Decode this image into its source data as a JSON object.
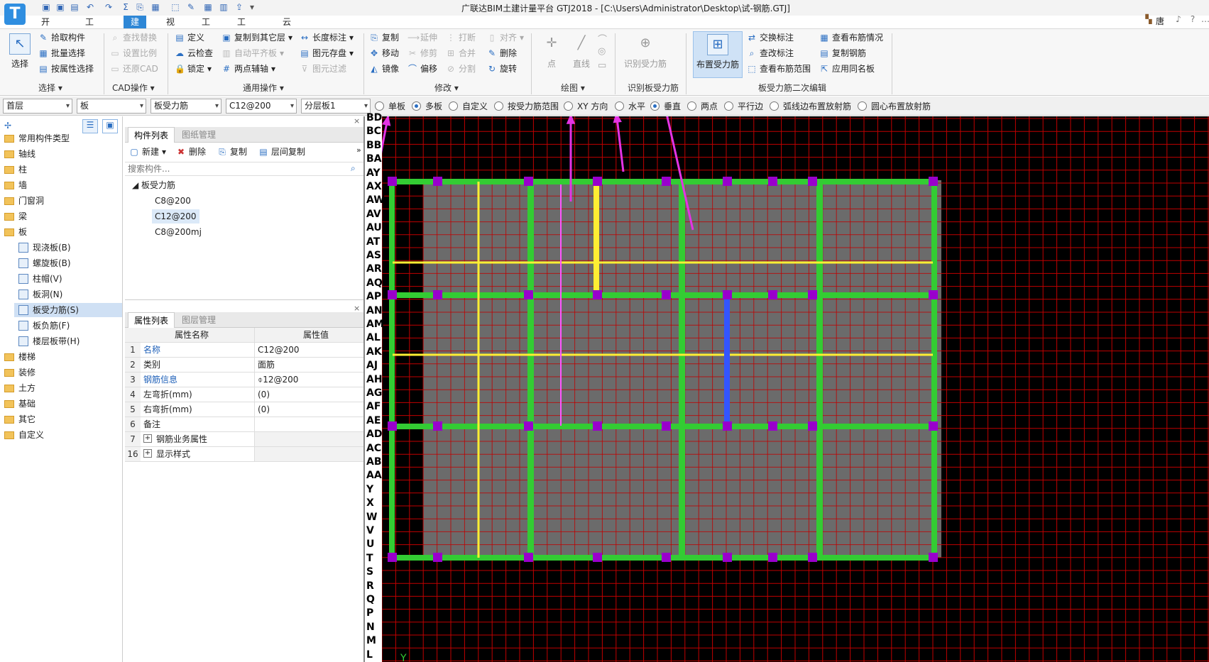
{
  "title": "广联达BIM土建计量平台 GTJ2018 - [C:\\Users\\Administrator\\Desktop\\试-钢筋.GTJ]",
  "user": "唐",
  "logo": "T",
  "menu_tabs": [
    "开始",
    "工程设置",
    "建模",
    "视图",
    "工具",
    "工程量",
    "云应用"
  ],
  "active_tab": "建模",
  "ribbon": {
    "select": {
      "big": "选择",
      "items": [
        "拾取构件",
        "批量选择",
        "按属性选择"
      ],
      "group": "选择"
    },
    "cad": {
      "items": [
        "查找替换",
        "设置比例",
        "还原CAD"
      ],
      "group": "CAD操作"
    },
    "common": {
      "items": [
        "定义",
        "云检查",
        "锁定",
        "复制到其它层",
        "自动平齐板",
        "两点辅轴",
        "长度标注",
        "图元存盘",
        "图元过滤"
      ],
      "group": "通用操作"
    },
    "modify": {
      "items": [
        "复制",
        "移动",
        "镜像",
        "延伸",
        "修剪",
        "偏移",
        "打断",
        "合并",
        "分割",
        "对齐",
        "删除",
        "旋转"
      ],
      "group": "修改"
    },
    "draw": {
      "items": [
        "点",
        "直线"
      ],
      "group": "绘图"
    },
    "identify": {
      "big": "识别受力筋",
      "group": "识别板受力筋"
    },
    "layout": {
      "big": "布置受力筋",
      "items": [
        "交换标注",
        "查改标注",
        "查看布筋范围",
        "查看布筋情况",
        "复制钢筋",
        "应用同名板"
      ],
      "group": "板受力筋二次编辑"
    }
  },
  "options": {
    "floor": "首层",
    "category": "板",
    "type": "板受力筋",
    "spec": "C12@200",
    "layer": "分层板1",
    "radios": [
      {
        "label": "单板",
        "on": false
      },
      {
        "label": "多板",
        "on": true
      },
      {
        "label": "自定义",
        "on": false
      },
      {
        "label": "按受力筋范围",
        "on": false
      },
      {
        "label": "XY 方向",
        "on": false
      },
      {
        "label": "水平",
        "on": false
      },
      {
        "label": "垂直",
        "on": true
      },
      {
        "label": "两点",
        "on": false
      },
      {
        "label": "平行边",
        "on": false
      },
      {
        "label": "弧线边布置放射筋",
        "on": false
      },
      {
        "label": "圆心布置放射筋",
        "on": false
      }
    ]
  },
  "tree": {
    "items": [
      "常用构件类型",
      "轴线",
      "柱",
      "墙",
      "门窗洞",
      "梁",
      "板"
    ],
    "sub": [
      "现浇板(B)",
      "螺旋板(B)",
      "柱帽(V)",
      "板洞(N)",
      "板受力筋(S)",
      "板负筋(F)",
      "楼层板带(H)"
    ],
    "after": [
      "楼梯",
      "装修",
      "土方",
      "基础",
      "其它",
      "自定义"
    ],
    "selected_sub": "板受力筋(S)"
  },
  "component_panel": {
    "tabs": [
      "构件列表",
      "图纸管理"
    ],
    "toolbar": [
      "新建",
      "删除",
      "复制",
      "层间复制"
    ],
    "search_placeholder": "搜索构件...",
    "group": "板受力筋",
    "items": [
      "C8@200",
      "C12@200",
      "C8@200mj"
    ],
    "selected": "C12@200"
  },
  "property_panel": {
    "tabs": [
      "属性列表",
      "图层管理"
    ],
    "headers": [
      "属性名称",
      "属性值"
    ],
    "rows": [
      {
        "n": "1",
        "k": "名称",
        "v": "C12@200",
        "blue": true
      },
      {
        "n": "2",
        "k": "类别",
        "v": "面筋",
        "blue": false
      },
      {
        "n": "3",
        "k": "钢筋信息",
        "v": "⌽12@200",
        "blue": true
      },
      {
        "n": "4",
        "k": "左弯折(mm)",
        "v": "(0)",
        "blue": false
      },
      {
        "n": "5",
        "k": "右弯折(mm)",
        "v": "(0)",
        "blue": false
      },
      {
        "n": "6",
        "k": "备注",
        "v": "",
        "blue": false
      },
      {
        "n": "7",
        "k": "钢筋业务属性",
        "v": "",
        "blue": false,
        "expand": true
      },
      {
        "n": "16",
        "k": "显示样式",
        "v": "",
        "blue": false,
        "expand": true
      }
    ]
  },
  "axis_labels": [
    "BD",
    "BC",
    "BB",
    "BA",
    "AY",
    "AX",
    "AW",
    "AV",
    "AU",
    "AT",
    "AS",
    "AR",
    "AQ",
    "AP",
    "AN",
    "AM",
    "AL",
    "AK",
    "AJ",
    "AH",
    "AG",
    "AF",
    "AE",
    "AD",
    "AC",
    "AB",
    "AA",
    "Y",
    "X",
    "W",
    "V",
    "U",
    "T",
    "S",
    "R",
    "Q",
    "P",
    "N",
    "M",
    "L"
  ],
  "canvas_y_label": "Y",
  "colors": {
    "accent": "#2e87d6",
    "grid": "#c00000",
    "slab": "#6b6b6b",
    "beam": "#33cc33",
    "rebar_yellow": "#ffee33",
    "rebar_blue": "#3355ff",
    "rebar_pink": "#ff55ff",
    "column": "#9900cc",
    "annotation": "#e433e4"
  }
}
